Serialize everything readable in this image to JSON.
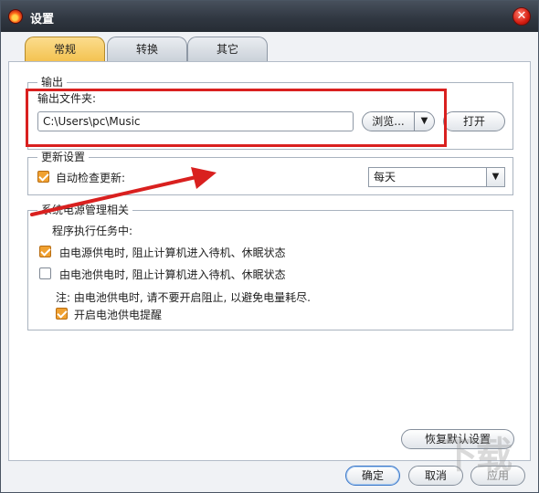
{
  "window": {
    "title": "设置"
  },
  "tabs": [
    {
      "label": "常规",
      "active": true
    },
    {
      "label": "转换",
      "active": false
    },
    {
      "label": "其它",
      "active": false
    }
  ],
  "output": {
    "legend": "输出",
    "folder_label": "输出文件夹:",
    "folder_value": "C:\\Users\\pc\\Music",
    "browse_label": "浏览...",
    "open_label": "打开"
  },
  "update": {
    "legend": "更新设置",
    "auto_check_label": "自动检查更新:",
    "auto_check_checked": true,
    "frequency_value": "每天"
  },
  "power": {
    "legend": "系统电源管理相关",
    "task_label": "程序执行任务中:",
    "ac_label": "由电源供电时, 阻止计算机进入待机、休眠状态",
    "ac_checked": true,
    "battery_label": "由电池供电时, 阻止计算机进入待机、休眠状态",
    "battery_checked": false,
    "note": "注: 由电池供电时, 请不要开启阻止, 以避免电量耗尽.",
    "reminder_label": "开启电池供电提醒",
    "reminder_checked": true
  },
  "footer": {
    "restore_label": "恢复默认设置",
    "ok_label": "确定",
    "cancel_label": "取消",
    "apply_label": "应用"
  },
  "colors": {
    "accent_tab": "#f3c14d",
    "checkbox_checked": "#f0a131",
    "annotation_red": "#d9201f"
  }
}
